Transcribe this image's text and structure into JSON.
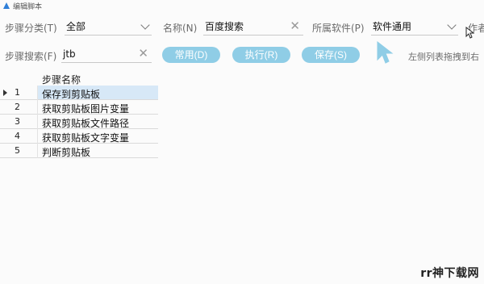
{
  "window": {
    "title": "编辑脚本"
  },
  "form": {
    "category_label": "步骤分类(T)",
    "category_value": "全部",
    "name_label": "名称(N)",
    "name_value": "百度搜索",
    "software_label": "所属软件(P)",
    "software_value": "软件通用",
    "author_label": "作者",
    "search_label": "步骤搜索(F)",
    "search_value": "jtb"
  },
  "buttons": {
    "common": "常用(D)",
    "execute": "执行(R)",
    "save": "保存(S)"
  },
  "hint": "左侧列表拖拽到右",
  "grid": {
    "column_header": "步骤名称",
    "rows": [
      {
        "num": "1",
        "name": "保存到剪贴板"
      },
      {
        "num": "2",
        "name": "获取剪贴板图片变量"
      },
      {
        "num": "3",
        "name": "获取剪贴板文件路径"
      },
      {
        "num": "4",
        "name": "获取剪贴板文字变量"
      },
      {
        "num": "5",
        "name": "判断剪贴板"
      }
    ]
  },
  "watermark": "rr神下载网",
  "colors": {
    "button_bg": "#8fcde6",
    "selection_bg": "#d7e8f7",
    "app_icon": "#2f7fd8"
  }
}
